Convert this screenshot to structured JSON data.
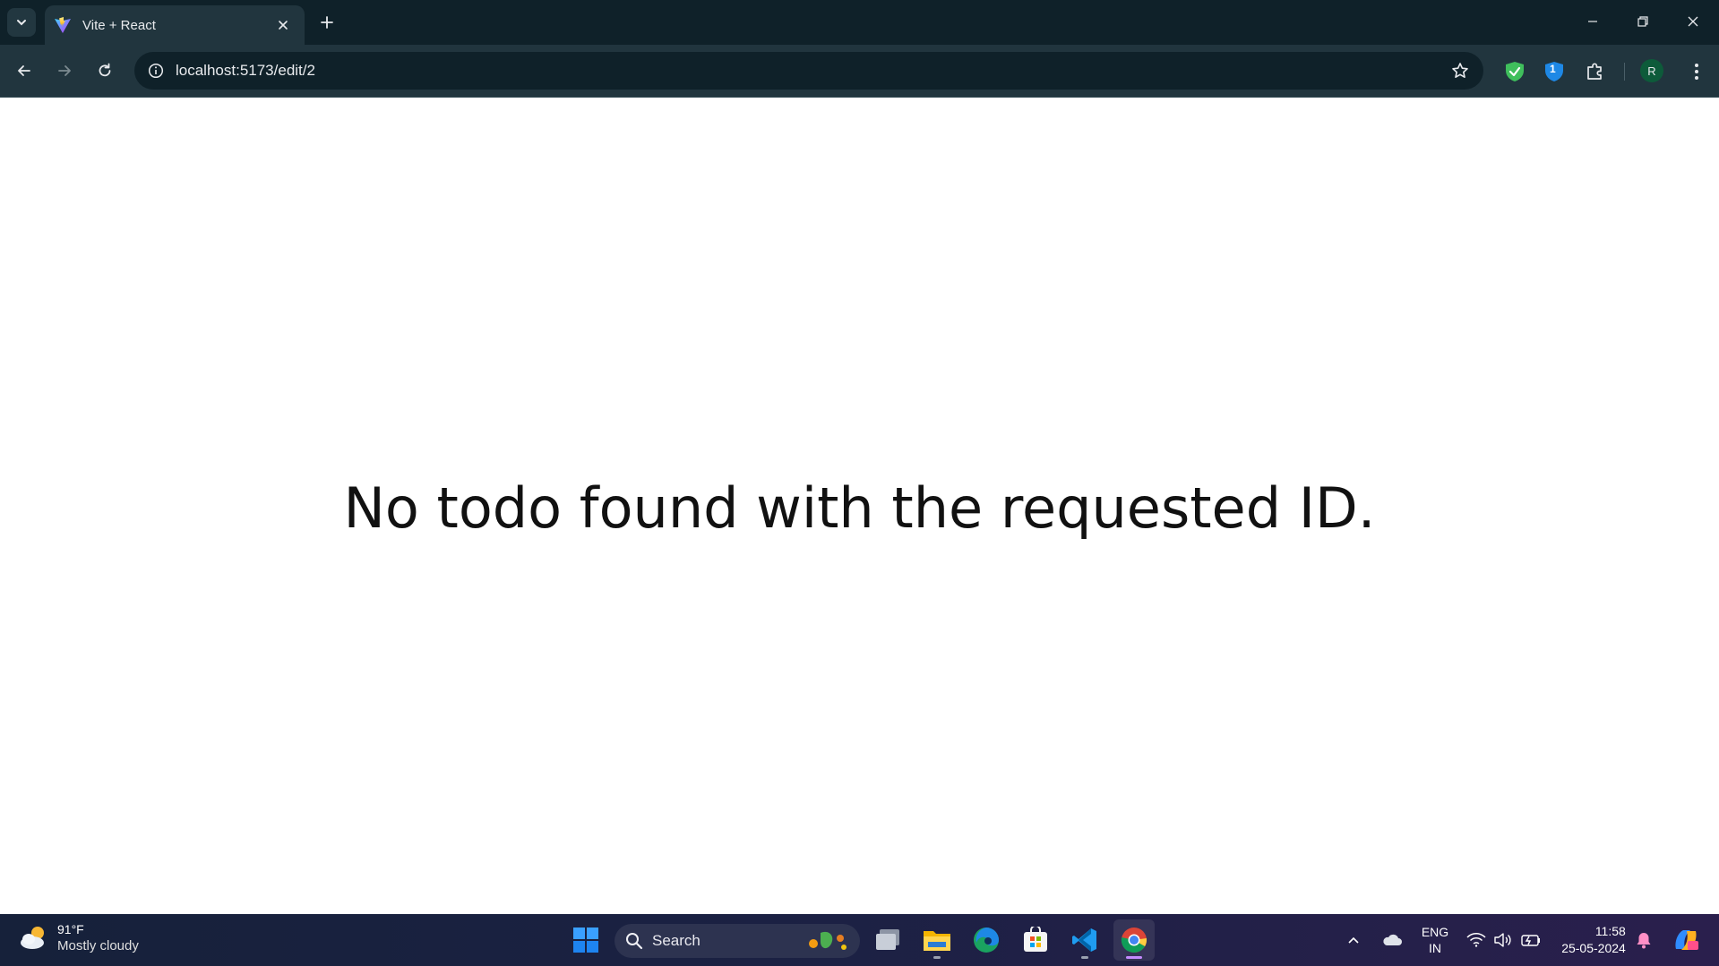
{
  "browser": {
    "tab": {
      "title": "Vite + React"
    },
    "address_bar": {
      "url": "localhost:5173/edit/2"
    },
    "profile_initial": "R",
    "extension_badge": "1",
    "icons": [
      "tab-search-icon",
      "vite-favicon-icon",
      "close-icon",
      "plus-icon",
      "minimize-icon",
      "restore-icon",
      "close-window-icon",
      "back-arrow-icon",
      "forward-arrow-icon",
      "reload-icon",
      "site-info-icon",
      "star-icon",
      "shield-check-icon",
      "shield-badge-icon",
      "puzzle-icon",
      "kebab-menu-icon"
    ]
  },
  "page": {
    "message": "No todo found with the requested ID."
  },
  "taskbar": {
    "weather": {
      "temp": "91°F",
      "condition": "Mostly cloudy"
    },
    "search": {
      "label": "Search"
    },
    "tray": {
      "language_line1": "ENG",
      "language_line2": "IN",
      "time": "11:58",
      "date": "25-05-2024"
    },
    "colors": {
      "accent_active": "#c48bff",
      "windows_blue": "#1e90ff"
    }
  }
}
